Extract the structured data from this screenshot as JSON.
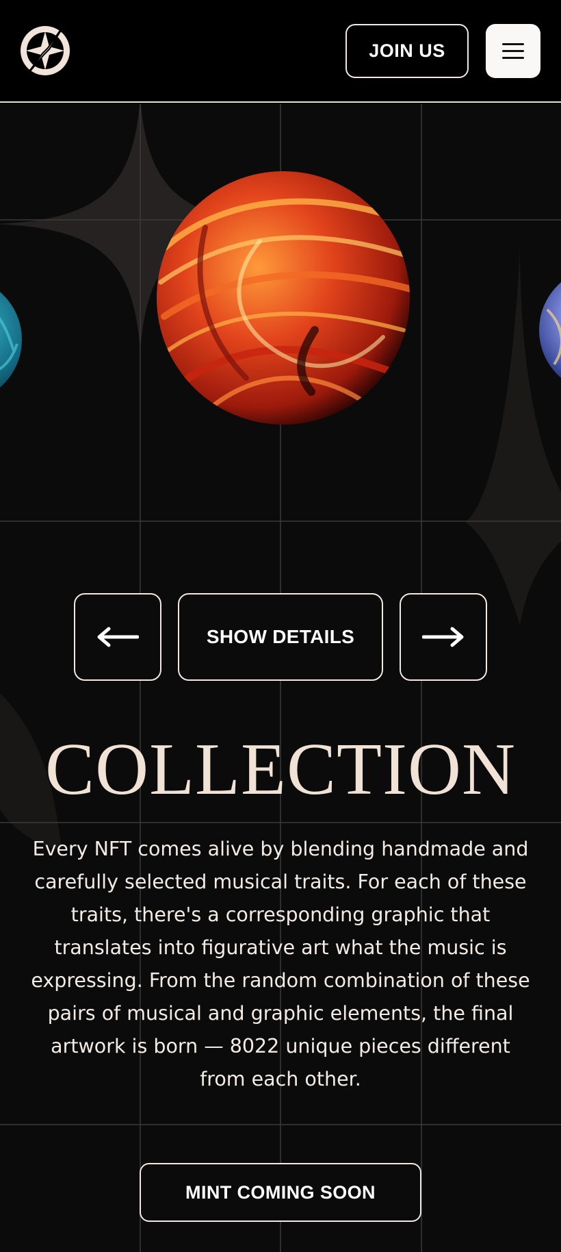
{
  "header": {
    "logo_name": "star-compass-logo",
    "join_label": "JOIN US",
    "menu_icon": "hamburger-icon"
  },
  "carousel": {
    "items": [
      {
        "name": "blue-sphere-artwork",
        "color": "#1c6f8a"
      },
      {
        "name": "red-orange-sphere-artwork",
        "color": "#d9371a"
      },
      {
        "name": "iridescent-sphere-artwork",
        "color": "#4a5fa8"
      }
    ],
    "prev_icon": "arrow-left-icon",
    "details_label": "SHOW DETAILS",
    "next_icon": "arrow-right-icon"
  },
  "collection": {
    "title": "COLLECTION",
    "description": "Every NFT comes alive by blending handmade and carefully selected musical traits. For each of these traits, there's a corresponding graphic that translates into figurative art what the music is expressing. From the random combination of these pairs of musical and graphic elements, the final artwork is born — 8022 unique pieces different from each other.",
    "mint_label": "MINT COMING SOON"
  },
  "colors": {
    "background": "#0b0b0b",
    "header_bg": "#000000",
    "text": "#f3e9e2",
    "title": "#f1e2d6",
    "menu_button_bg": "#faf8f6"
  }
}
